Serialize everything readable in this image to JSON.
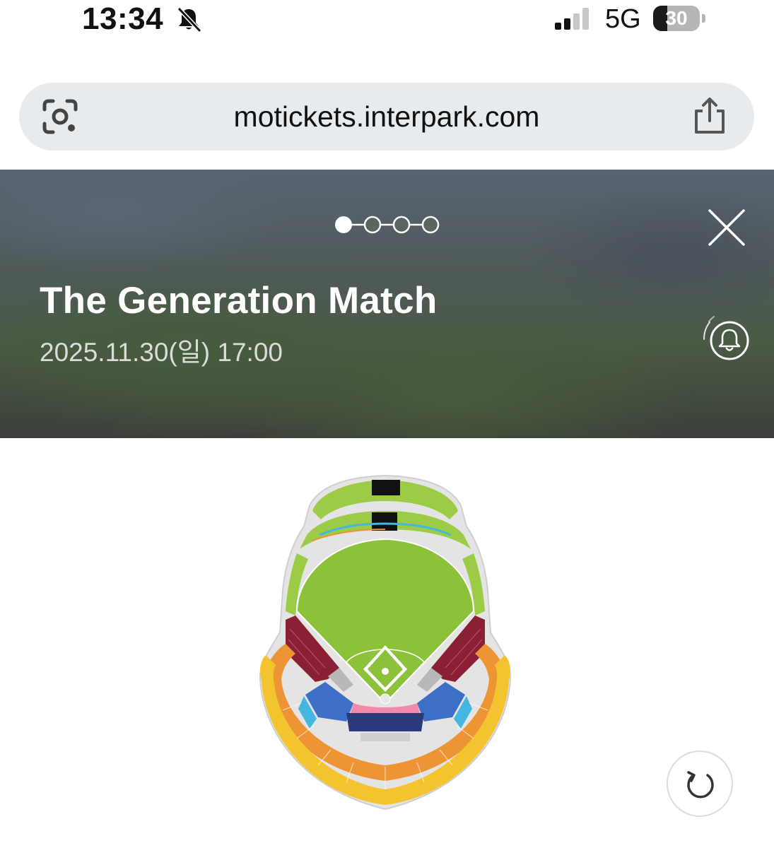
{
  "status_bar": {
    "time": "13:34",
    "network": "5G",
    "battery_percent": "30",
    "battery_level": 0.3,
    "icons": [
      "bell-slash-icon",
      "signal-bars-icon",
      "battery-icon"
    ]
  },
  "address_bar": {
    "url": "motickets.interpark.com",
    "icons": [
      "google-lens-icon",
      "share-icon"
    ]
  },
  "hero": {
    "title": "The Generation Match",
    "date": "2025.11.30(일) 17:00",
    "pager": {
      "total": 4,
      "current": 1
    },
    "icons": [
      "close-icon",
      "alarm-bell-icon"
    ]
  },
  "seat_map": {
    "colors": {
      "outfield_green": "#9ccb45",
      "field_green": "#8cc13a",
      "maroon": "#8a2036",
      "navy": "#2c3a7d",
      "blue": "#3d6fc7",
      "cyan": "#45b6e0",
      "pink": "#f08aa8",
      "orange": "#ed9434",
      "yellow": "#f4c430",
      "gray": "#d5d5d5",
      "black": "#111111"
    }
  },
  "controls": {
    "refresh_icon": "refresh-icon"
  }
}
